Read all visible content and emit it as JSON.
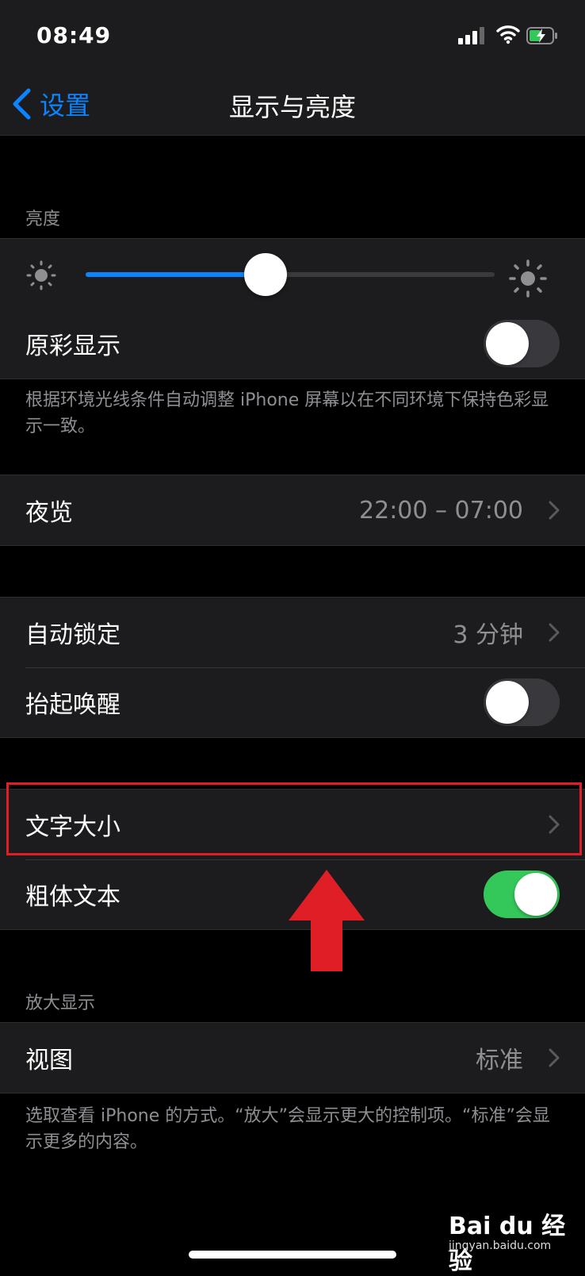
{
  "status_bar": {
    "time": "08:49"
  },
  "nav": {
    "back_label": "设置",
    "title": "显示与亮度"
  },
  "brightness": {
    "header": "亮度",
    "level": 0.44,
    "true_tone_label": "原彩显示",
    "true_tone_on": false,
    "footer": "根据环境光线条件自动调整 iPhone 屏幕以在不同环境下保持色彩显示一致。"
  },
  "night_shift": {
    "label": "夜览",
    "value": "22:00 – 07:00"
  },
  "lock": {
    "auto_lock_label": "自动锁定",
    "auto_lock_value": "3 分钟",
    "raise_to_wake_label": "抬起唤醒",
    "raise_to_wake_on": false
  },
  "text": {
    "text_size_label": "文字大小",
    "bold_text_label": "粗体文本",
    "bold_text_on": true
  },
  "zoom": {
    "header": "放大显示",
    "view_label": "视图",
    "view_value": "标准",
    "footer": "选取查看 iPhone 的方式。“放大”会显示更大的控制项。“标准”会显示更多的内容。"
  },
  "watermark": {
    "logo": "Bai du 经验",
    "url": "jingyan.baidu.com"
  },
  "colors": {
    "accent": "#0a84ff",
    "switch_on": "#34c759",
    "highlight": "#e01e26"
  }
}
